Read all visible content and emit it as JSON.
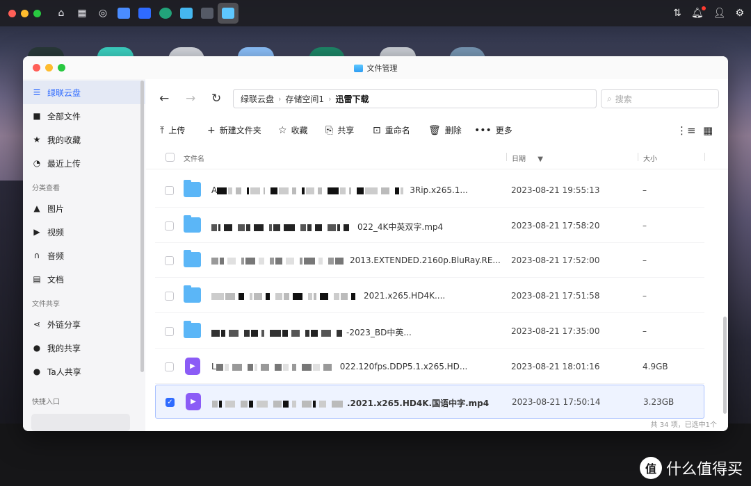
{
  "window": {
    "title": "文件管理"
  },
  "sidebar": {
    "items": [
      {
        "label": "绿联云盘",
        "icon": "storage-icon",
        "active": true
      },
      {
        "label": "全部文件",
        "icon": "folder-icon"
      },
      {
        "label": "我的收藏",
        "icon": "star-icon"
      },
      {
        "label": "最近上传",
        "icon": "clock-icon"
      }
    ],
    "section_category": "分类查看",
    "category_items": [
      {
        "label": "图片",
        "icon": "image-icon"
      },
      {
        "label": "视频",
        "icon": "video-icon"
      },
      {
        "label": "音频",
        "icon": "headphones-icon"
      },
      {
        "label": "文档",
        "icon": "document-icon"
      }
    ],
    "section_share": "文件共享",
    "share_items": [
      {
        "label": "外链分享",
        "icon": "share-icon"
      },
      {
        "label": "我的共享",
        "icon": "users-icon"
      },
      {
        "label": "Ta人共享",
        "icon": "users-icon"
      }
    ],
    "section_quick": "快捷入口"
  },
  "breadcrumb": {
    "items": [
      "绿联云盘",
      "存储空间1",
      "迅雷下载"
    ]
  },
  "search": {
    "placeholder": "搜索"
  },
  "toolbar": {
    "upload": "上传",
    "new_folder": "新建文件夹",
    "favorite": "收藏",
    "share": "共享",
    "rename": "重命名",
    "delete": "删除",
    "more": "更多"
  },
  "table": {
    "headers": {
      "name": "文件名",
      "date": "日期",
      "size": "大小"
    },
    "rows": [
      {
        "type": "folder",
        "name_prefix": "A",
        "name_suffix": "3Rip.x265.1...",
        "date": "2023-08-21 19:55:13",
        "size": "–",
        "selected": false
      },
      {
        "type": "folder",
        "name_prefix": "",
        "name_suffix": "022_4K中英双字.mp4",
        "date": "2023-08-21 17:58:20",
        "size": "–",
        "selected": false
      },
      {
        "type": "folder",
        "name_prefix": "",
        "name_suffix": "2013.EXTENDED.2160p.BluRay.RE...",
        "date": "2023-08-21 17:52:00",
        "size": "–",
        "selected": false
      },
      {
        "type": "folder",
        "name_prefix": "",
        "name_suffix": "2021.x265.HD4K....",
        "date": "2023-08-21 17:51:58",
        "size": "–",
        "selected": false
      },
      {
        "type": "folder",
        "name_prefix": "",
        "name_suffix": "-2023_BD中英...",
        "date": "2023-08-21 17:35:00",
        "size": "–",
        "selected": false
      },
      {
        "type": "video",
        "name_prefix": "L",
        "name_suffix": "022.120fps.DDP5.1.x265.HD...",
        "date": "2023-08-21 18:01:16",
        "size": "4.9GB",
        "selected": false
      },
      {
        "type": "video",
        "name_prefix": "",
        "name_suffix": ".2021.x265.HD4K.国语中字.mp4",
        "date": "2023-08-21 17:50:14",
        "size": "3.23GB",
        "selected": true
      }
    ]
  },
  "footer": {
    "status": "共 34 项，已选中1个"
  },
  "watermark": {
    "text": "什么值得买",
    "logo": "值"
  },
  "colors": {
    "accent": "#2f6bff",
    "folder": "#5bb6f7",
    "video": "#8b5cf6"
  }
}
